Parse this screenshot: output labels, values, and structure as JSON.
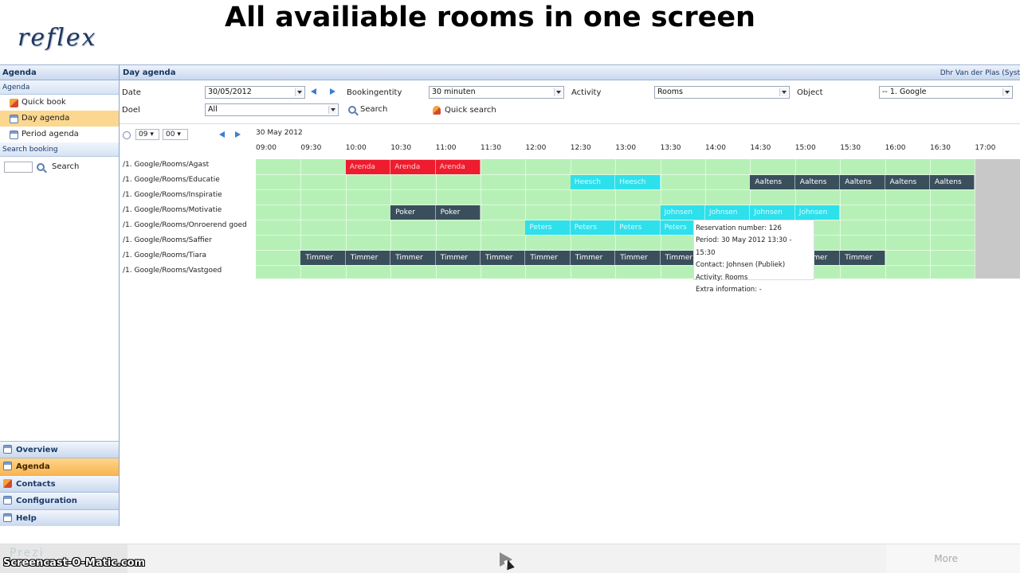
{
  "headline": "All availiable rooms in one screen",
  "logo": "reflex",
  "sidebar": {
    "header": "Agenda",
    "section1": "Agenda",
    "items": [
      {
        "label": "Quick book",
        "icon": "book-icon"
      },
      {
        "label": "Day agenda",
        "icon": "calendar-icon",
        "active": true
      },
      {
        "label": "Period agenda",
        "icon": "calendar-icon"
      }
    ],
    "section2": "Search booking",
    "search_label": "Search",
    "nav": [
      {
        "label": "Overview",
        "icon": "overview-icon"
      },
      {
        "label": "Agenda",
        "icon": "agenda-icon",
        "active": true
      },
      {
        "label": "Contacts",
        "icon": "contacts-icon"
      },
      {
        "label": "Configuration",
        "icon": "configuration-icon"
      },
      {
        "label": "Help",
        "icon": "help-icon"
      }
    ]
  },
  "main": {
    "title": "Day agenda",
    "user": "Dhr Van der Plas (Syst",
    "filters": {
      "date_label": "Date",
      "date_value": "30/05/2012",
      "doel_label": "Doel",
      "doel_value": "All",
      "bookingentity_label": "Bookingentity",
      "bookingentity_value": "30 minuten",
      "search_label": "Search",
      "quick_search_label": "Quick search",
      "activity_label": "Activity",
      "activity_value": "Rooms",
      "object_label": "Object",
      "object_value": "-- 1. Google"
    },
    "time_hour": "09",
    "time_minute": "00",
    "day_label": "30 May 2012",
    "times": [
      "09:00",
      "09:30",
      "10:00",
      "10:30",
      "11:00",
      "11:30",
      "12:00",
      "12:30",
      "13:00",
      "13:30",
      "14:00",
      "14:30",
      "15:00",
      "15:30",
      "16:00",
      "16:30",
      "17:00"
    ],
    "rooms": [
      "/1. Google/Rooms/Agast",
      "/1. Google/Rooms/Educatie",
      "/1. Google/Rooms/Inspiratie",
      "/1. Google/Rooms/Motivatie",
      "/1. Google/Rooms/Onroerend goed",
      "/1. Google/Rooms/Saffier",
      "/1. Google/Rooms/Tiara",
      "/1. Google/Rooms/Vastgoed"
    ],
    "bookings": [
      {
        "row": 0,
        "start": 2,
        "end": 5,
        "label": "Arenda",
        "color": "red"
      },
      {
        "row": 1,
        "start": 7,
        "end": 9,
        "label": "Heesch",
        "color": "cyan"
      },
      {
        "row": 1,
        "start": 11,
        "end": 16,
        "label": "Aaltens",
        "color": "dark"
      },
      {
        "row": 3,
        "start": 3,
        "end": 5,
        "label": "Poker",
        "color": "dark"
      },
      {
        "row": 3,
        "start": 9,
        "end": 13,
        "label": "Johnsen",
        "color": "cyan"
      },
      {
        "row": 4,
        "start": 6,
        "end": 10,
        "label": "Peters",
        "color": "cyan"
      },
      {
        "row": 6,
        "start": 1,
        "end": 10,
        "label": "Timmer",
        "color": "dark"
      },
      {
        "row": 6,
        "start": 12,
        "end": 14,
        "label": "Timmer",
        "color": "dark"
      }
    ],
    "tooltip": {
      "line1": "Reservation number: 126",
      "line2": "Period: 30 May 2012 13:30 - 15:30",
      "line3": "Contact: Johnsen (Publiek)",
      "line4": "Activity: Rooms",
      "line5": "Extra information: -"
    }
  },
  "bottom": {
    "more": "More",
    "watermark": "Screencast-O-Matic.com",
    "prezi": "Prezi"
  }
}
